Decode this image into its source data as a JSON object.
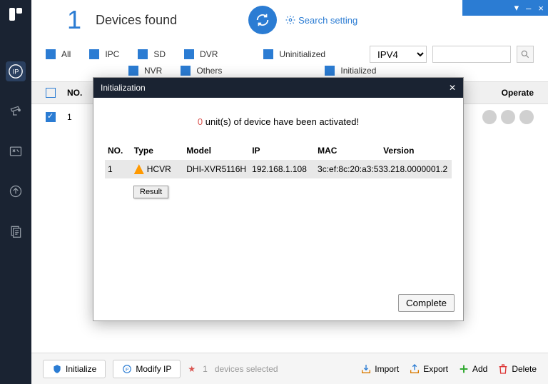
{
  "header": {
    "count": "1",
    "label": "Devices found",
    "search_setting": "Search setting"
  },
  "filters": {
    "all": "All",
    "ipc": "IPC",
    "sd": "SD",
    "dvr": "DVR",
    "nvr": "NVR",
    "others": "Others",
    "uninitialized": "Uninitialized",
    "initialized": "Initialized",
    "ip_version": "IPV4"
  },
  "table": {
    "headers": {
      "no": "NO.",
      "operate": "Operate"
    },
    "rows": [
      {
        "no": "1"
      }
    ]
  },
  "modal": {
    "title": "Initialization",
    "activated_count": "0",
    "activated_text": " unit(s) of device have been activated!",
    "headers": {
      "no": "NO.",
      "type": "Type",
      "model": "Model",
      "ip": "IP",
      "mac": "MAC",
      "version": "Version"
    },
    "rows": [
      {
        "no": "1",
        "type": "HCVR",
        "model": "DHI-XVR5116H",
        "ip": "192.168.1.108",
        "mac": "3c:ef:8c:20:a3:53",
        "version": "3.218.0000001.2"
      }
    ],
    "result_btn": "Result",
    "complete_btn": "Complete"
  },
  "bottom": {
    "initialize": "Initialize",
    "modify_ip": "Modify IP",
    "selected_count": "1",
    "selected_label": "devices selected",
    "import": "Import",
    "export": "Export",
    "add": "Add",
    "delete": "Delete"
  }
}
